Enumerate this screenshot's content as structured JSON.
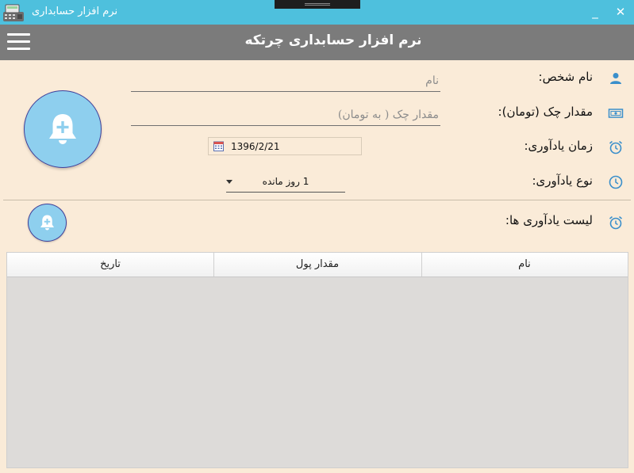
{
  "window": {
    "title": "نرم افزار حسابداری",
    "minimize_label": "_",
    "close_label": "✕"
  },
  "header": {
    "title": "نرم افزار حسابداری چرتکه",
    "menu_icon": "hamburger-menu-icon"
  },
  "form": {
    "person": {
      "label": "نام شخص:",
      "placeholder": "نام",
      "icon": "person-icon"
    },
    "amount": {
      "label": "مقدار چک (تومان):",
      "placeholder": "مقدار چک ( به تومان)",
      "icon": "money-icon"
    },
    "reminder_time": {
      "label": "زمان یادآوری:",
      "date_value": "1396/2/21",
      "icon": "alarm-clock-icon"
    },
    "reminder_type": {
      "label": "نوع یادآوری:",
      "selected": "1 روز مانده",
      "icon": "clock-icon"
    },
    "add_reminder_button": "bell-plus-icon"
  },
  "reminders": {
    "label": "لیست یادآوری ها:",
    "icon": "alarm-clock-icon",
    "columns": [
      "نام",
      "مقدار پول",
      "تاریخ"
    ],
    "rows": []
  },
  "colors": {
    "titlebar": "#4EC0DD",
    "header": "#7B7B7B",
    "background": "#FAEBD8",
    "accent": "#8ECFEE",
    "icon": "#3A8FCB"
  }
}
